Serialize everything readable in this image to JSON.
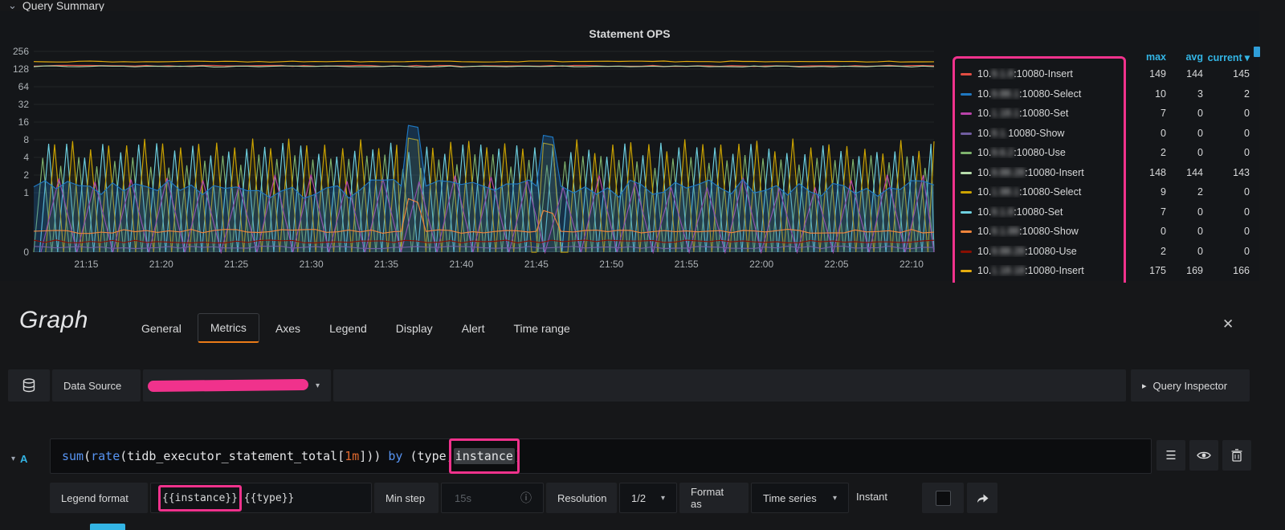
{
  "accent": {
    "pink": "#f0328c",
    "orange": "#eb7b18",
    "blue": "#33b5e5"
  },
  "row_header": {
    "title": "Query Summary",
    "chevron": "⌄"
  },
  "panel": {
    "title": "Statement OPS",
    "legend_headers": [
      "max",
      "avg",
      "current"
    ],
    "sort_caret": "▾",
    "legend_rows": [
      {
        "color": "#e24d42",
        "visible_prefix": "10.",
        "blurred": "9.1.8",
        "label": ":10080-Insert",
        "max": "149",
        "avg": "144",
        "current": "145"
      },
      {
        "color": "#1f78c1",
        "visible_prefix": "10.",
        "blurred": "9.88.1",
        "label": ":10080-Select",
        "max": "10",
        "avg": "3",
        "current": "2"
      },
      {
        "color": "#ba43a9",
        "visible_prefix": "10.",
        "blurred": "1.18.1",
        "label": ":10080-Set",
        "max": "7",
        "avg": "0",
        "current": "0"
      },
      {
        "color": "#705da0",
        "visible_prefix": "10.",
        "blurred": "9.1.",
        "label": "10080-Show",
        "max": "0",
        "avg": "0",
        "current": "0"
      },
      {
        "color": "#7eb26d",
        "visible_prefix": "10.",
        "blurred": "9.6.2",
        "label": ":10080-Use",
        "max": "2",
        "avg": "0",
        "current": "0"
      },
      {
        "color": "#b7dbab",
        "visible_prefix": "10.",
        "blurred": "9.88.28",
        "label": ":10080-Insert",
        "max": "148",
        "avg": "144",
        "current": "143"
      },
      {
        "color": "#cca300",
        "visible_prefix": "10.",
        "blurred": "1.98.1",
        "label": ":10080-Select",
        "max": "9",
        "avg": "2",
        "current": "0"
      },
      {
        "color": "#6ed0e0",
        "visible_prefix": "10.",
        "blurred": "9.1.8",
        "label": ":10080-Set",
        "max": "7",
        "avg": "0",
        "current": "0"
      },
      {
        "color": "#ef843c",
        "visible_prefix": "10.",
        "blurred": "9.1.88",
        "label": ":10080-Show",
        "max": "0",
        "avg": "0",
        "current": "0"
      },
      {
        "color": "#890f02",
        "visible_prefix": "10.",
        "blurred": "9.88.28",
        "label": ":10080-Use",
        "max": "2",
        "avg": "0",
        "current": "0"
      },
      {
        "color": "#e5ac0e",
        "visible_prefix": "10.",
        "blurred": "1.18.18",
        "label": ":10080-Insert",
        "max": "175",
        "avg": "169",
        "current": "166"
      }
    ]
  },
  "chart_data": {
    "type": "line",
    "title": "Statement OPS",
    "y_scale": "log2",
    "ylim": [
      0,
      256
    ],
    "y_ticks": [
      "256",
      "128",
      "64",
      "32",
      "16",
      "8",
      "4",
      "2",
      "1",
      "0"
    ],
    "x_ticks": [
      "21:15",
      "21:20",
      "21:25",
      "21:30",
      "21:35",
      "21:40",
      "21:45",
      "21:50",
      "21:55",
      "22:00",
      "22:05",
      "22:10"
    ],
    "grid": "horizontal",
    "legend_position": "right-table",
    "series": [
      {
        "name": "10080-Use (green)",
        "color": "#7eb26d",
        "type": "saw",
        "min": 0,
        "max": 3.5,
        "period": 72
      },
      {
        "name": "10080-Set (cyan)",
        "color": "#6ed0e0",
        "type": "saw",
        "min": 0,
        "max": 5.5,
        "period": 72,
        "phase": 0.33,
        "fill": 0.06
      },
      {
        "name": "10080-Select (tan)",
        "color": "#cca300",
        "type": "saw",
        "min": 0,
        "max": 6.5,
        "period": 72,
        "phase": 0.66,
        "fill": 0.09,
        "spikes": [
          {
            "t": 1530,
            "v": 8.5
          },
          {
            "t": 2070,
            "v": 7
          }
        ]
      },
      {
        "name": "10080-Set (magenta)",
        "color": "#ba43a9",
        "type": "saw",
        "min": 0,
        "max": 1.6,
        "period": 144,
        "phase": 0.2
      },
      {
        "name": "10080-Select (blue)",
        "color": "#1f78c1",
        "type": "flat",
        "value": 1.3,
        "noise": 0.8,
        "fill": 0.28,
        "spikes": [
          {
            "t": 1530,
            "v": 14
          },
          {
            "t": 2070,
            "v": 9.5
          }
        ]
      },
      {
        "name": "10080-Show (orange)",
        "color": "#ef843c",
        "type": "flat",
        "value": 0.35,
        "noise": 0.07,
        "spikes": [
          {
            "t": 1530,
            "v": 0.9
          },
          {
            "t": 2070,
            "v": 0.7
          }
        ]
      },
      {
        "name": "10080-Use (dark red)",
        "color": "#890f02",
        "type": "flat",
        "value": 0.18,
        "noise": 0.05
      },
      {
        "name": "10080-Show (purple)",
        "color": "#705da0",
        "type": "flat",
        "value": 0.08,
        "noise": 0.04
      },
      {
        "name": "10080-Insert (red)",
        "color": "#e24d42",
        "type": "flat",
        "value": 145,
        "noise": 7
      },
      {
        "name": "10080-Insert (light green)",
        "color": "#b7dbab",
        "type": "flat",
        "value": 142,
        "noise": 6
      },
      {
        "name": "10080-Insert (yellow)",
        "color": "#e5ac0e",
        "type": "flat",
        "value": 172,
        "noise": 7
      }
    ]
  },
  "editor": {
    "panel_type": "Graph",
    "tabs": [
      "General",
      "Metrics",
      "Axes",
      "Legend",
      "Display",
      "Alert",
      "Time range"
    ],
    "active_tab": "Metrics",
    "close_label": "✕",
    "datasource": {
      "label": "Data Source",
      "dropdown_caret": "▾",
      "query_inspector_caret": "▸",
      "query_inspector": "Query Inspector"
    },
    "query": {
      "collapse_caret": "▾",
      "ref": "A",
      "tokens": [
        {
          "c": "k",
          "t": "sum"
        },
        {
          "c": "n",
          "t": "("
        },
        {
          "c": "k",
          "t": "rate"
        },
        {
          "c": "n",
          "t": "("
        },
        {
          "c": "n",
          "t": "tidb_executor_statement_total"
        },
        {
          "c": "n",
          "t": "["
        },
        {
          "c": "d",
          "t": "1m"
        },
        {
          "c": "n",
          "t": "]"
        },
        {
          "c": "n",
          "t": "))"
        },
        {
          "c": "n",
          "t": " "
        },
        {
          "c": "k",
          "t": "by"
        },
        {
          "c": "n",
          "t": " ("
        },
        {
          "c": "n",
          "t": "type,"
        },
        {
          "c": "h",
          "t": "instance",
          "box": true
        },
        {
          "c": "n",
          "t": ")"
        }
      ]
    },
    "options": {
      "legend_format_label": "Legend format",
      "legend_format_highlight": "{{instance}}",
      "legend_format_rest": " {{type}}",
      "min_step_label": "Min step",
      "min_step_placeholder": "15s",
      "info_icon": "ⓘ",
      "resolution_label": "Resolution",
      "resolution_value": "1/2",
      "format_as_label": "Format as",
      "format_as_value": "Time series",
      "instant_label": "Instant",
      "instant_checked": false
    }
  }
}
